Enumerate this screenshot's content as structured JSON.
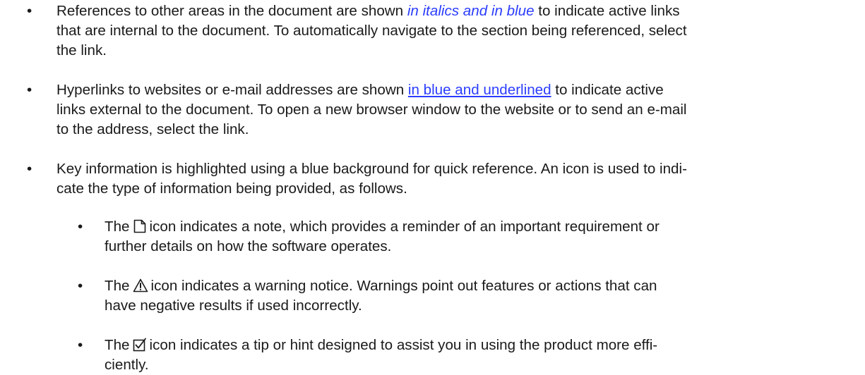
{
  "bullet_char": "•",
  "items": [
    {
      "line1_pre": "References to other areas in the document are shown ",
      "link": "in italics and in blue",
      "line1_post": " to indicate active links",
      "line2": "that are internal to the document. To automatically navigate to the section being referenced, select",
      "line3": "the link."
    },
    {
      "line1_pre": "Hyperlinks to websites or e-mail addresses are shown ",
      "link": "in blue and underlined",
      "line1_post": " to indicate active",
      "line2": "links external to the document. To open a new browser window to the website or to send an e-mail",
      "line3": "to the address, select the link."
    },
    {
      "line1": "Key information is highlighted using a blue background for quick reference. An icon is used to indi-",
      "line2": "cate the type of information being provided, as follows."
    }
  ],
  "subitems": [
    {
      "icon": "note-icon",
      "pre": "The",
      "line1_post": "icon indicates a note, which provides a reminder of an important requirement or",
      "line2": "further details on how the software operates."
    },
    {
      "icon": "warning-icon",
      "pre": "The",
      "line1_post": "icon indicates a warning notice. Warnings point out features or actions that can",
      "line2": "have negative results if used incorrectly."
    },
    {
      "icon": "tip-icon",
      "pre": "The",
      "line1_post": "icon indicates a tip or hint designed to assist you in using the product more effi-",
      "line2": "ciently."
    }
  ]
}
